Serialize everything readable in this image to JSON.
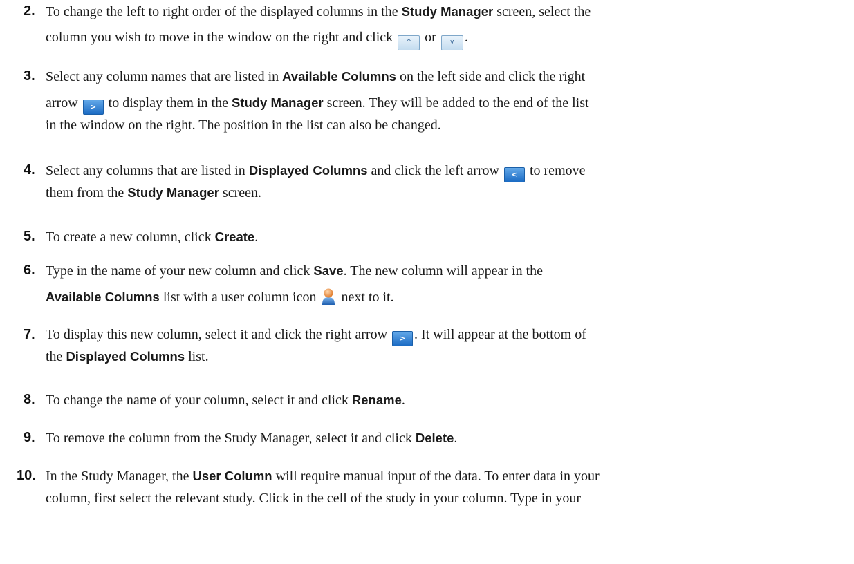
{
  "steps": [
    {
      "num": "2.",
      "l1": [
        "To change the left to right order of the displayed columns in the ",
        "Study Manager",
        " screen, select the"
      ],
      "l2": [
        "column you wish to move in the window on the right and click ",
        " or ",
        "."
      ],
      "icons": [
        "up-arrow-button-icon",
        "down-arrow-button-icon"
      ],
      "glyphs": [
        "^",
        "v"
      ]
    },
    {
      "num": "3.",
      "l1": [
        "Select any column names that are listed in ",
        "Available Columns",
        " on the left side and click the right"
      ],
      "l2": [
        "arrow ",
        " to display them in the ",
        "Study Manager",
        " screen. They will be added to the end of the list"
      ],
      "l3": "in the window on the right. The position in the list can also be changed.",
      "icons": [
        "right-arrow-button-icon"
      ],
      "glyphs": [
        ">"
      ]
    },
    {
      "num": "4.",
      "l1": [
        "Select any columns that are listed in ",
        "Displayed Columns",
        " and click the left arrow ",
        " to remove"
      ],
      "l2": [
        "them from the ",
        "Study Manager",
        " screen."
      ],
      "icons": [
        "left-arrow-button-icon"
      ],
      "glyphs": [
        "<"
      ]
    },
    {
      "num": "5.",
      "l1": [
        "To create a new column, click ",
        "Create",
        "."
      ]
    },
    {
      "num": "6.",
      "l1": [
        "Type in the name of your new column and click ",
        "Save",
        ". The new column will appear in the"
      ],
      "l2": [
        "Available Columns",
        " list with a user column icon ",
        " next to it."
      ],
      "icons": [
        "user-column-icon"
      ]
    },
    {
      "num": "7.",
      "l1": [
        "To display this new column, select it and click the right arrow ",
        ". It will appear at the bottom of"
      ],
      "l2": [
        "the ",
        "Displayed Columns",
        " list."
      ],
      "icons": [
        "right-arrow-button-icon"
      ],
      "glyphs": [
        ">"
      ]
    },
    {
      "num": "8.",
      "l1": [
        "To change the name of your column, select it and click ",
        "Rename",
        "."
      ]
    },
    {
      "num": "9.",
      "l1": [
        "To remove the column from the Study Manager, select it and click ",
        "Delete",
        "."
      ]
    },
    {
      "num": "10.",
      "l1": [
        "In the Study Manager, the ",
        "User Column",
        " will require manual input of the data. To enter data in your"
      ],
      "l2": "column, first select the relevant study. Click in the cell of the study in your column. Type in your"
    }
  ]
}
